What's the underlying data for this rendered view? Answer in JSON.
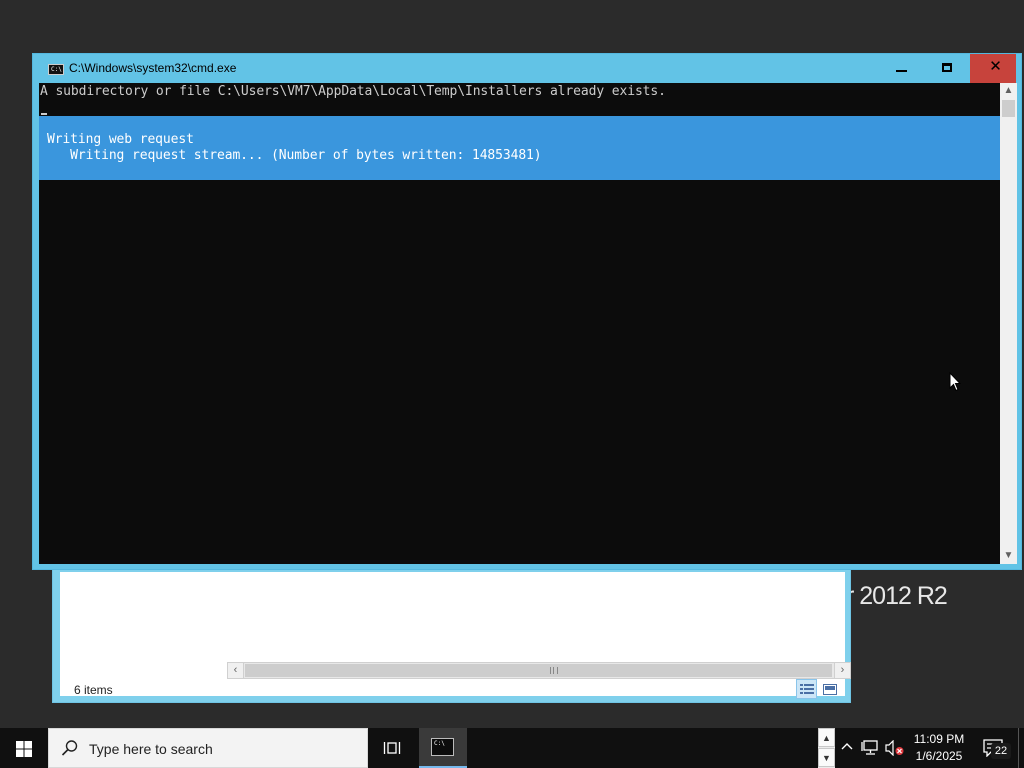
{
  "desktop": {
    "brand_text": "r 2012 R2"
  },
  "explorer": {
    "status_count": "6 items",
    "hscroll_left_icon": "chevron-left-icon",
    "hscroll_right_icon": "chevron-right-icon"
  },
  "cmd": {
    "title": "C:\\Windows\\system32\\cmd.exe",
    "icon_text": "C:\\",
    "controls": {
      "minimize": "minimize-icon",
      "maximize": "maximize-icon",
      "close_glyph": "✕"
    },
    "console_lines": [
      "A subdirectory or file C:\\Users\\VM7\\AppData\\Local\\Temp\\Installers already exists."
    ],
    "progress": {
      "activity": "Writing web request",
      "status": "   Writing request stream... (Number of bytes written: 14853481)"
    },
    "colors": {
      "console_bg": "#0c0c0c",
      "console_fg": "#cccccc",
      "progress_bg": "#3a96dd",
      "title_bg": "#62c3e6",
      "close_bg": "#c7433c"
    }
  },
  "taskbar": {
    "search_placeholder": "Type here to search",
    "tb_cmd_icon_text": "C:\\",
    "clock_time": "11:09 PM",
    "clock_date": "1/6/2025",
    "notification_count": "22",
    "kbd_up": "▲",
    "kbd_down": "▼"
  }
}
